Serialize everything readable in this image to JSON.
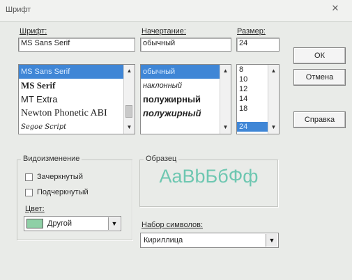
{
  "window": {
    "title": "Шрифт",
    "close_glyph": "✕"
  },
  "font": {
    "label": "Шрифт:",
    "value": "MS Sans Serif",
    "items": [
      "MS Sans Serif",
      "MS Serif",
      "MT Extra",
      "Newton Phonetic ABI",
      "Segoe Script"
    ],
    "selected_index": 0
  },
  "style": {
    "label": "Начертание:",
    "value": "обычный",
    "items": [
      "обычный",
      "наклонный",
      "полужирный",
      "полужирный"
    ],
    "selected_index": 0
  },
  "size": {
    "label": "Размер:",
    "value": "24",
    "items": [
      "8",
      "10",
      "12",
      "14",
      "18",
      "24"
    ],
    "selected_index": 5
  },
  "buttons": {
    "ok": "ОК",
    "cancel": "Отмена",
    "help": "Справка"
  },
  "effects": {
    "label": "Видоизменение",
    "strikeout": "Зачеркнутый",
    "underline": "Подчеркнутый",
    "color_label": "Цвет:",
    "color_value": "Другой",
    "color_swatch": "#8fd0a6"
  },
  "sample": {
    "label": "Образец",
    "text": "AaBbБбФф",
    "text_color": "#6ec7b1"
  },
  "script": {
    "label": "Набор символов:",
    "value": "Кириллица"
  },
  "colors": {
    "selection": "#3f86d6",
    "background": "#e9ebe8"
  }
}
